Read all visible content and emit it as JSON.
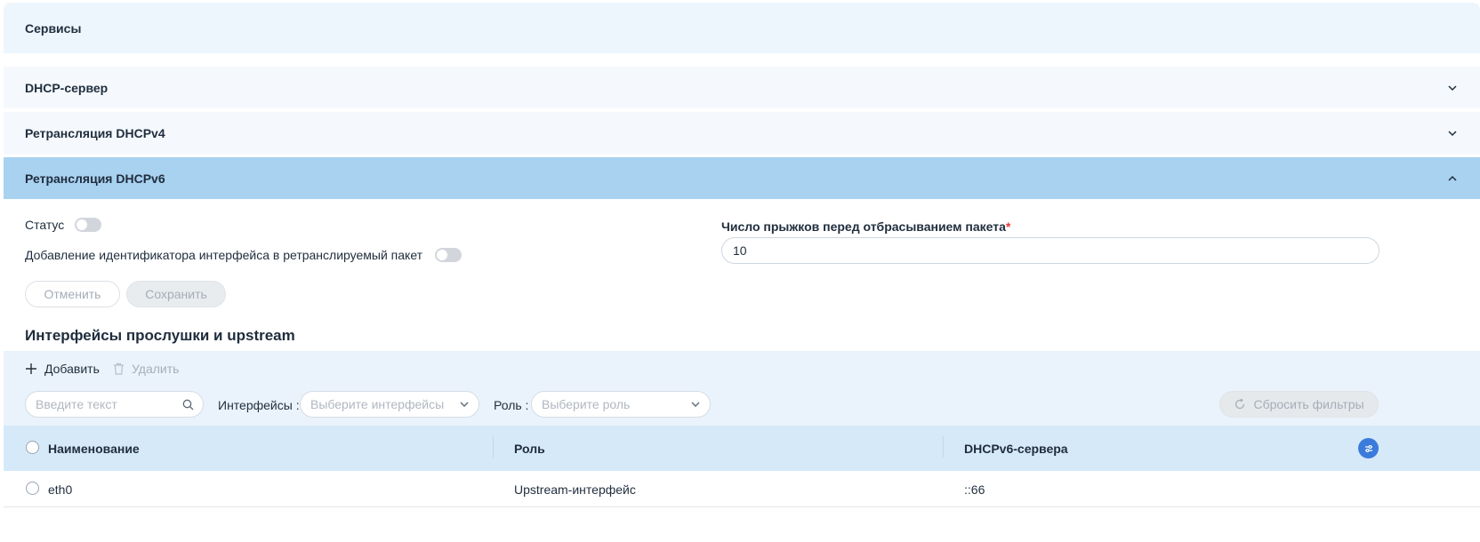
{
  "section": {
    "title": "Сервисы"
  },
  "accordions": [
    {
      "label": "DHCP-сервер",
      "expanded": false
    },
    {
      "label": "Ретрансляция DHCPv4",
      "expanded": false
    },
    {
      "label": "Ретрансляция DHCPv6",
      "expanded": true
    }
  ],
  "form": {
    "status_label": "Статус",
    "status_on": false,
    "iface_id_label": "Добавление идентификатора интерфейса в ретранслируемый пакет",
    "iface_id_on": false,
    "hops_label": "Число прыжков перед отбрасыванием пакета",
    "hops_required_mark": "*",
    "hops_value": "10",
    "cancel_label": "Отменить",
    "save_label": "Сохранить"
  },
  "interfaces": {
    "title": "Интерфейсы прослушки и upstream",
    "add_label": "Добавить",
    "delete_label": "Удалить",
    "search_placeholder": "Введите текст",
    "filter_interfaces_label": "Интерфейсы :",
    "filter_interfaces_placeholder": "Выберите интерфейсы",
    "filter_role_label": "Роль :",
    "filter_role_placeholder": "Выберите роль",
    "reset_label": "Сбросить фильтры",
    "columns": [
      "Наименование",
      "Роль",
      "DHCPv6-сервера"
    ],
    "rows": [
      {
        "name": "eth0",
        "role": "Upstream-интерфейс",
        "servers": "::66"
      }
    ]
  },
  "colors": {
    "accent": "#3b7bdc",
    "active_accordion": "#a9d1f0",
    "required": "#e53935"
  }
}
